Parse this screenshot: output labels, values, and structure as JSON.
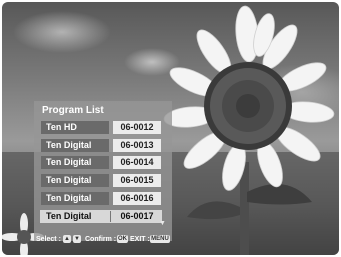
{
  "program_list": {
    "title": "Program List",
    "channels": [
      {
        "name": "Ten HD",
        "number": "06-0012"
      },
      {
        "name": "Ten Digital",
        "number": "06-0013"
      },
      {
        "name": "Ten Digital",
        "number": "06-0014"
      },
      {
        "name": "Ten Digital",
        "number": "06-0015"
      },
      {
        "name": "Ten Digital",
        "number": "06-0016"
      },
      {
        "name": "Ten Digital",
        "number": "06-0017"
      }
    ],
    "selected_index": 5
  },
  "help_bar": {
    "select_label": "Select :",
    "confirm_label": "Confirm :",
    "ok_key": "OK",
    "exit_label": "EXIT :",
    "menu_key": "MENU"
  }
}
